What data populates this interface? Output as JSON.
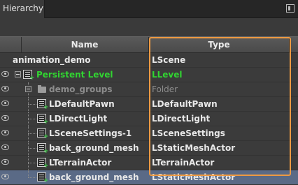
{
  "panel": {
    "title": "Hierarchy"
  },
  "columns": {
    "name": "Name",
    "type": "Type"
  },
  "rows": [
    {
      "name": "animation_demo",
      "type": "LScene"
    },
    {
      "name": "Persistent Level",
      "type": "LLevel"
    },
    {
      "name": "demo_groups",
      "type": "Folder"
    },
    {
      "name": "LDefaultPawn",
      "type": "LDefaultPawn"
    },
    {
      "name": "LDirectLight",
      "type": "LDirectLight"
    },
    {
      "name": "LSceneSettings-1",
      "type": "LSceneSettings"
    },
    {
      "name": "back_ground_mesh",
      "type": "LStaticMeshActor"
    },
    {
      "name": "LTerrainActor",
      "type": "LTerrainActor"
    },
    {
      "name": "back_ground_mesh",
      "type": "LStaticMeshActor"
    }
  ],
  "colors": {
    "highlight": "#ee9a42",
    "level_green": "#31d531",
    "selected_row": "#5a6a86"
  }
}
